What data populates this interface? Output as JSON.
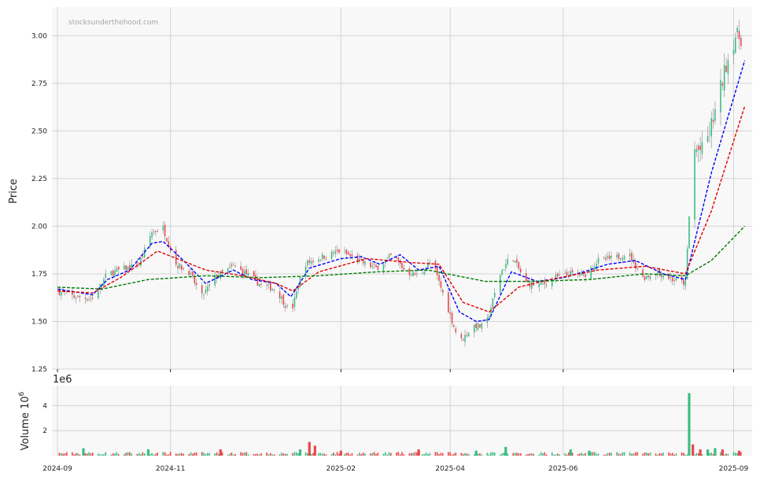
{
  "watermark": "stocksunderthehood.com",
  "colors": {
    "up": "#3cbc84",
    "down": "#e8484b",
    "ma_fast": "#0000ff",
    "ma_mid": "#e00000",
    "ma_slow": "#007a00",
    "panel_bg": "#f8f8f8",
    "grid": "#d4d4d4"
  },
  "chart_data": {
    "type": "candlestick",
    "ylabel": "Price",
    "ylim": [
      1.25,
      3.15
    ],
    "yticks": [
      "1.25",
      "1.50",
      "1.75",
      "2.00",
      "2.25",
      "2.50",
      "2.75",
      "3.00"
    ],
    "xticks": [
      "2024-09",
      "2024-11",
      "2025-02",
      "2025-04",
      "2025-06",
      "2025-09"
    ],
    "xrange": [
      "2024-08-29",
      "2025-09-11"
    ],
    "grid": true,
    "price_path": [
      [
        "2024-09-01",
        1.66
      ],
      [
        "2024-09-10",
        1.63
      ],
      [
        "2024-09-20",
        1.62
      ],
      [
        "2024-09-28",
        1.75
      ],
      [
        "2024-10-08",
        1.78
      ],
      [
        "2024-10-15",
        1.8
      ],
      [
        "2024-10-22",
        1.97
      ],
      [
        "2024-10-28",
        1.99
      ],
      [
        "2024-11-04",
        1.8
      ],
      [
        "2024-11-11",
        1.76
      ],
      [
        "2024-11-18",
        1.63
      ],
      [
        "2024-11-25",
        1.73
      ],
      [
        "2024-12-05",
        1.79
      ],
      [
        "2024-12-12",
        1.75
      ],
      [
        "2024-12-20",
        1.69
      ],
      [
        "2024-12-28",
        1.67
      ],
      [
        "2025-01-05",
        1.54
      ],
      [
        "2025-01-12",
        1.8
      ],
      [
        "2025-01-22",
        1.84
      ],
      [
        "2025-02-01",
        1.87
      ],
      [
        "2025-02-10",
        1.82
      ],
      [
        "2025-02-20",
        1.78
      ],
      [
        "2025-03-01",
        1.85
      ],
      [
        "2025-03-08",
        1.76
      ],
      [
        "2025-03-15",
        1.74
      ],
      [
        "2025-03-22",
        1.82
      ],
      [
        "2025-03-29",
        1.62
      ],
      [
        "2025-04-06",
        1.39
      ],
      [
        "2025-04-14",
        1.48
      ],
      [
        "2025-04-20",
        1.47
      ],
      [
        "2025-04-28",
        1.75
      ],
      [
        "2025-05-04",
        1.85
      ],
      [
        "2025-05-12",
        1.7
      ],
      [
        "2025-05-20",
        1.69
      ],
      [
        "2025-05-28",
        1.73
      ],
      [
        "2025-06-05",
        1.75
      ],
      [
        "2025-06-12",
        1.74
      ],
      [
        "2025-06-20",
        1.82
      ],
      [
        "2025-06-28",
        1.83
      ],
      [
        "2025-07-06",
        1.86
      ],
      [
        "2025-07-14",
        1.73
      ],
      [
        "2025-07-22",
        1.76
      ],
      [
        "2025-07-30",
        1.72
      ],
      [
        "2025-08-06",
        1.7
      ],
      [
        "2025-08-10",
        2.4
      ],
      [
        "2025-08-16",
        2.4
      ],
      [
        "2025-08-22",
        2.6
      ],
      [
        "2025-08-28",
        2.85
      ],
      [
        "2025-09-02",
        3.0
      ],
      [
        "2025-09-07",
        2.98
      ]
    ],
    "moving_averages": [
      {
        "color_key": "ma_fast",
        "points": [
          [
            "2024-09-01",
            1.67
          ],
          [
            "2024-09-20",
            1.64
          ],
          [
            "2024-09-28",
            1.72
          ],
          [
            "2024-10-10",
            1.77
          ],
          [
            "2024-10-22",
            1.91
          ],
          [
            "2024-10-28",
            1.92
          ],
          [
            "2024-11-08",
            1.82
          ],
          [
            "2024-11-20",
            1.7
          ],
          [
            "2024-12-05",
            1.77
          ],
          [
            "2024-12-15",
            1.72
          ],
          [
            "2024-12-28",
            1.7
          ],
          [
            "2025-01-05",
            1.63
          ],
          [
            "2025-01-15",
            1.78
          ],
          [
            "2025-02-01",
            1.83
          ],
          [
            "2025-02-12",
            1.84
          ],
          [
            "2025-02-22",
            1.8
          ],
          [
            "2025-03-05",
            1.85
          ],
          [
            "2025-03-15",
            1.77
          ],
          [
            "2025-03-26",
            1.79
          ],
          [
            "2025-04-06",
            1.55
          ],
          [
            "2025-04-15",
            1.5
          ],
          [
            "2025-04-22",
            1.51
          ],
          [
            "2025-05-04",
            1.76
          ],
          [
            "2025-05-18",
            1.71
          ],
          [
            "2025-06-01",
            1.73
          ],
          [
            "2025-06-12",
            1.76
          ],
          [
            "2025-06-25",
            1.8
          ],
          [
            "2025-07-10",
            1.82
          ],
          [
            "2025-07-25",
            1.75
          ],
          [
            "2025-08-06",
            1.72
          ],
          [
            "2025-08-20",
            2.28
          ],
          [
            "2025-09-07",
            2.87
          ]
        ]
      },
      {
        "color_key": "ma_mid",
        "points": [
          [
            "2024-09-01",
            1.66
          ],
          [
            "2024-09-20",
            1.65
          ],
          [
            "2024-10-05",
            1.73
          ],
          [
            "2024-10-25",
            1.87
          ],
          [
            "2024-11-20",
            1.77
          ],
          [
            "2024-12-10",
            1.74
          ],
          [
            "2024-12-28",
            1.7
          ],
          [
            "2025-01-06",
            1.66
          ],
          [
            "2025-01-20",
            1.76
          ],
          [
            "2025-02-15",
            1.83
          ],
          [
            "2025-03-10",
            1.81
          ],
          [
            "2025-03-26",
            1.8
          ],
          [
            "2025-04-08",
            1.6
          ],
          [
            "2025-04-22",
            1.55
          ],
          [
            "2025-05-08",
            1.68
          ],
          [
            "2025-05-25",
            1.72
          ],
          [
            "2025-06-20",
            1.77
          ],
          [
            "2025-07-15",
            1.79
          ],
          [
            "2025-08-06",
            1.75
          ],
          [
            "2025-08-20",
            2.08
          ],
          [
            "2025-09-07",
            2.63
          ]
        ]
      },
      {
        "color_key": "ma_slow",
        "points": [
          [
            "2024-09-01",
            1.68
          ],
          [
            "2024-09-25",
            1.67
          ],
          [
            "2024-10-20",
            1.72
          ],
          [
            "2024-11-20",
            1.74
          ],
          [
            "2024-12-20",
            1.73
          ],
          [
            "2025-01-20",
            1.74
          ],
          [
            "2025-02-20",
            1.76
          ],
          [
            "2025-03-20",
            1.77
          ],
          [
            "2025-04-20",
            1.71
          ],
          [
            "2025-05-15",
            1.71
          ],
          [
            "2025-06-15",
            1.72
          ],
          [
            "2025-07-15",
            1.75
          ],
          [
            "2025-08-06",
            1.74
          ],
          [
            "2025-08-20",
            1.82
          ],
          [
            "2025-09-07",
            2.0
          ]
        ]
      }
    ],
    "volume": {
      "ylabel": "Volume",
      "ylabel_exponent": "6",
      "offset_label": "1e6",
      "ylim": [
        0,
        5.6
      ],
      "yticks": [
        "2",
        "4"
      ],
      "spikes": [
        [
          "2024-09-15",
          0.6,
          "up"
        ],
        [
          "2024-10-20",
          0.5,
          "up"
        ],
        [
          "2024-11-28",
          0.5,
          "down"
        ],
        [
          "2025-01-10",
          0.5,
          "up"
        ],
        [
          "2025-01-15",
          1.1,
          "down"
        ],
        [
          "2025-01-18",
          0.8,
          "down"
        ],
        [
          "2025-02-01",
          0.4,
          "down"
        ],
        [
          "2025-03-15",
          0.5,
          "down"
        ],
        [
          "2025-04-15",
          0.4,
          "up"
        ],
        [
          "2025-05-01",
          0.7,
          "up"
        ],
        [
          "2025-06-05",
          0.5,
          "up"
        ],
        [
          "2025-06-15",
          0.4,
          "up"
        ],
        [
          "2025-08-08",
          5.0,
          "up"
        ],
        [
          "2025-08-10",
          0.9,
          "down"
        ],
        [
          "2025-08-14",
          0.5,
          "down"
        ],
        [
          "2025-08-18",
          0.5,
          "up"
        ],
        [
          "2025-08-22",
          0.6,
          "up"
        ],
        [
          "2025-08-26",
          0.5,
          "down"
        ],
        [
          "2025-09-04",
          0.4,
          "down"
        ]
      ]
    }
  }
}
